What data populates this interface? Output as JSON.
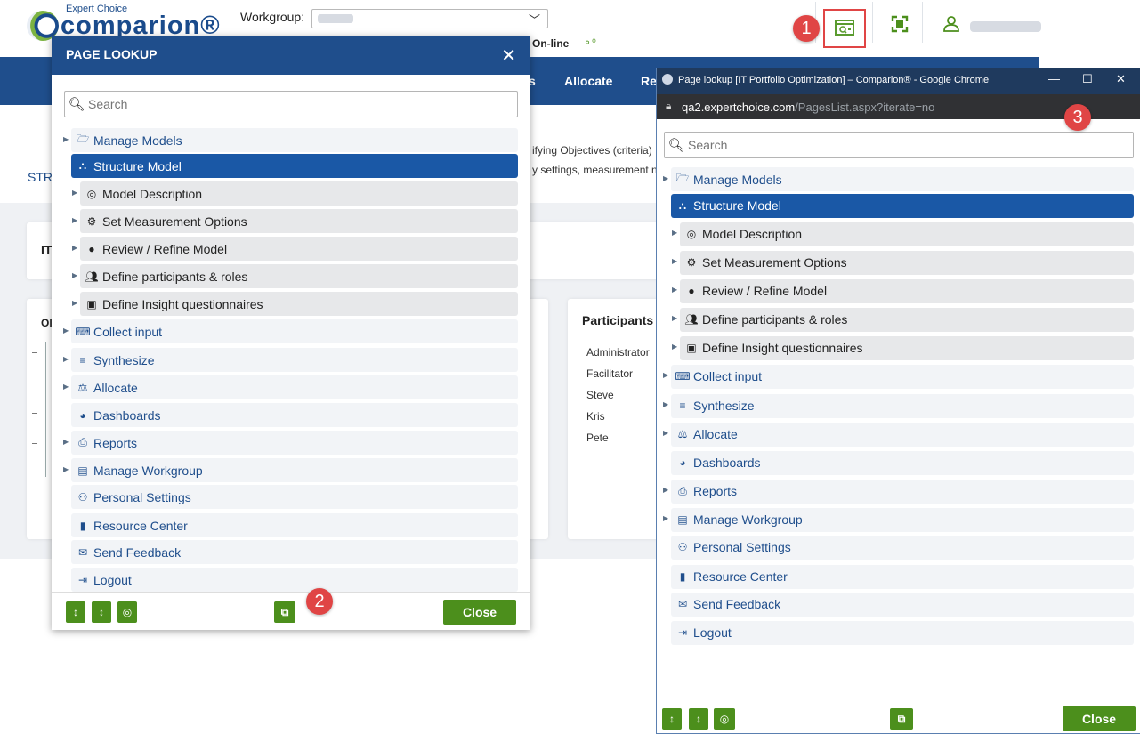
{
  "app": {
    "brand_small": "Expert Choice",
    "brand": "comparion®",
    "workgroup_label": "Workgroup:",
    "status": "On-line",
    "nav": [
      "s",
      "Allocate",
      "Re"
    ],
    "str_fragment": "STR",
    "frag1": "ifying Objectives (criteria)",
    "frag2": "y settings, measurement n",
    "it_fragment": "IT",
    "ol_fragment": "Ol",
    "participants_title": "Participants",
    "participants": [
      "Administrator",
      "Facilitator",
      "Steve",
      "Kris",
      "Pete"
    ]
  },
  "badges": [
    "1",
    "2",
    "3"
  ],
  "modal": {
    "title": "PAGE LOOKUP",
    "search_placeholder": "Search",
    "close_label": "Close"
  },
  "popup": {
    "window_title": "Page lookup [IT Portfolio Optimization] – Comparion® - Google Chrome",
    "url_host": "qa2.expertchoice.com",
    "url_path": "/PagesList.aspx?iterate=no",
    "search_placeholder": "Search",
    "close_label": "Close"
  },
  "menu": [
    {
      "label": "Manage Models",
      "icon": "folder-open-icon"
    },
    {
      "label": "Structure Model",
      "icon": "sitemap-icon"
    },
    {
      "label": "Model Description",
      "icon": "target-icon"
    },
    {
      "label": "Set Measurement Options",
      "icon": "cogs-icon"
    },
    {
      "label": "Review / Refine Model",
      "icon": "circle-icon"
    },
    {
      "label": "Define participants & roles",
      "icon": "users-icon"
    },
    {
      "label": "Define Insight questionnaires",
      "icon": "clipboard-check-icon"
    },
    {
      "label": "Collect input",
      "icon": "keyboard-icon"
    },
    {
      "label": "Synthesize",
      "icon": "bar-chart-icon"
    },
    {
      "label": "Allocate",
      "icon": "balance-scale-icon"
    },
    {
      "label": "Dashboards",
      "icon": "dashboard-icon"
    },
    {
      "label": "Reports",
      "icon": "print-icon"
    },
    {
      "label": "Manage Workgroup",
      "icon": "server-icon"
    },
    {
      "label": "Personal Settings",
      "icon": "user-cog-icon"
    },
    {
      "label": "Resource Center",
      "icon": "book-icon"
    },
    {
      "label": "Send Feedback",
      "icon": "envelope-icon"
    },
    {
      "label": "Logout",
      "icon": "sign-out-icon"
    }
  ]
}
